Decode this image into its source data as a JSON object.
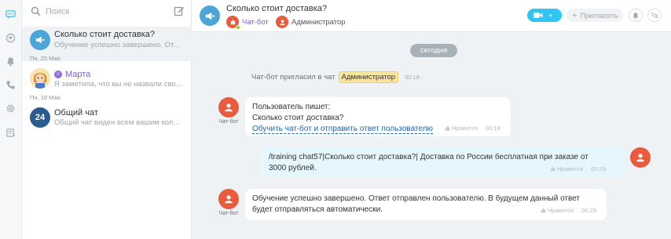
{
  "search": {
    "placeholder": "Поиск"
  },
  "chats": [
    {
      "title": "Сколько стоит доставка?",
      "preview": "Обучение успешно завершено. От..."
    },
    {
      "date": "Пн, 25 Мая",
      "title": "Марта",
      "preview": "Я заметила, что вы не назвали сво..."
    },
    {
      "date": "Пн, 18 Мая",
      "title": "Общий чат",
      "preview": "Общий чат виден всем вашим кол...",
      "avatar_text": "24"
    }
  ],
  "header": {
    "title": "Сколько стоит доставка?",
    "participants": [
      {
        "label": "Чат-бот"
      },
      {
        "label": "Администратор"
      }
    ],
    "invite_label": "Пригласить"
  },
  "messages": {
    "day": "сегодня",
    "system": {
      "text": "Чат-бот пригласил в чат",
      "mention": "Администратор",
      "time": "00:18"
    },
    "m1": {
      "author": "Чат-бот",
      "line1": "Пользователь пишет:",
      "line2": "Сколько стоит доставка?",
      "link": "Обучить чат-бот и отправить ответ пользователю",
      "like": "Нравится",
      "time": "00:18"
    },
    "m2": {
      "text": "/training chat57|Сколько стоит доставка?| Доставка по России бесплатная при заказе от 3000 рублей.",
      "like": "Нравится",
      "time": "00:29"
    },
    "m3": {
      "author": "Чат-бот",
      "text": "Обучение успешно завершено. Ответ отправлен пользователю. В будущем данный ответ будет отправляться автоматически.",
      "like": "Нравится",
      "time": "00:29"
    }
  },
  "colors": {
    "accent": "#2fc6f6",
    "bot": "#e85b3d",
    "openlines": "#4ba5d7",
    "highlight": "#fbe59d"
  }
}
